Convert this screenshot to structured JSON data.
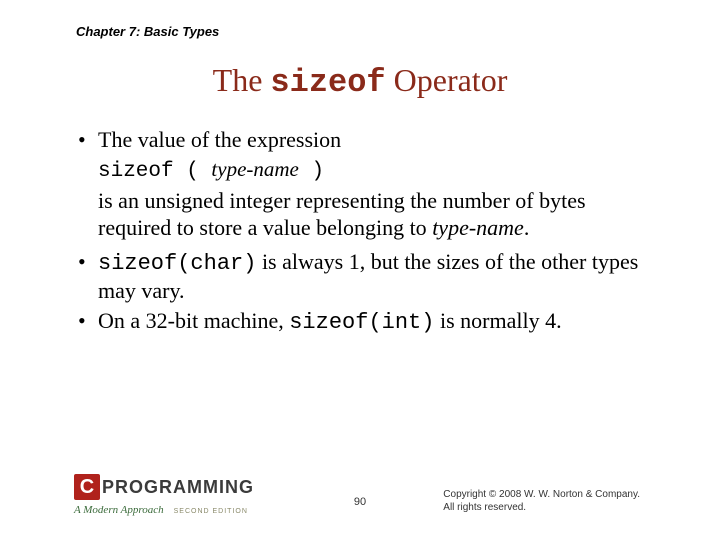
{
  "chapter": "Chapter 7: Basic Types",
  "title": {
    "pre": "The ",
    "code": "sizeof",
    "post": " Operator"
  },
  "bullet1": "The value of the expression",
  "codeLine": {
    "a": "sizeof ( ",
    "b": "type-name",
    "c": " )"
  },
  "follow1": {
    "a": "is an unsigned integer representing the number of bytes required to store a value belonging to ",
    "b": "type-name",
    "c": "."
  },
  "bullet2": {
    "a": "sizeof(char)",
    "b": " is always 1, but the sizes of the other types may vary."
  },
  "bullet3": {
    "a": "On a 32-bit machine, ",
    "b": "sizeof(int)",
    "c": " is normally 4."
  },
  "logo": {
    "c": "C",
    "word": "PROGRAMMING",
    "sub": "A Modern Approach",
    "ed": "SECOND EDITION"
  },
  "pageNumber": "90",
  "copyright": {
    "l1": "Copyright © 2008 W. W. Norton & Company.",
    "l2": "All rights reserved."
  }
}
